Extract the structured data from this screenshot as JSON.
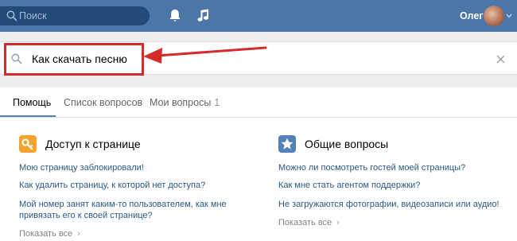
{
  "header": {
    "search_placeholder": "Поиск",
    "user_name": "Олег"
  },
  "search": {
    "value": "Как скачать песню"
  },
  "tabs": [
    {
      "label": "Помощь",
      "active": true
    },
    {
      "label": "Список вопросов",
      "active": false
    },
    {
      "label": "Мои вопросы",
      "count": "1",
      "active": false
    }
  ],
  "sections": [
    {
      "title": "Доступ к странице",
      "icon": "key-icon",
      "icon_color": "#f2a42c",
      "questions": [
        "Мою страницу заблокировали!",
        "Как удалить страницу, к которой нет доступа?",
        "Мой номер занят каким-то пользователем, как мне",
        "привязать его к своей странице?"
      ],
      "show_all": "Показать все"
    },
    {
      "title": "Общие вопросы",
      "icon": "star-icon",
      "icon_color": "#5181b8",
      "questions": [
        "Можно ли посмотреть гостей моей страницы?",
        "Как мне стать агентом поддержки?",
        "Не загружаются фотографии, видеозаписи или аудио!"
      ],
      "show_all": "Показать все"
    }
  ],
  "colors": {
    "header_bg": "#4a76a8",
    "accent": "#5181b8",
    "link": "#2a5885",
    "annotation_red": "#d52b2b"
  }
}
